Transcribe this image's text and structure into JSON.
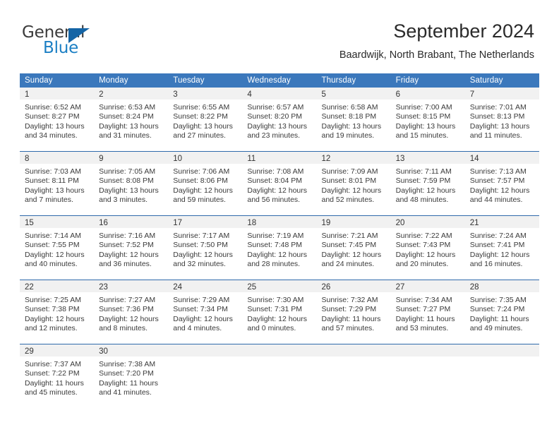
{
  "brand": {
    "word_one": "General",
    "word_two": "Blue",
    "triangle_color": "#1464a5",
    "blue_text_color": "#1b7fc4"
  },
  "header": {
    "title": "September 2024",
    "subtitle": "Baardwijk, North Brabant, The Netherlands"
  },
  "theme": {
    "header_blue": "#3b78bc",
    "daynum_band": "#f1f1f1",
    "row_divider": "#2f6aab",
    "text": "#3a3a3a"
  },
  "weekdays": [
    "Sunday",
    "Monday",
    "Tuesday",
    "Wednesday",
    "Thursday",
    "Friday",
    "Saturday"
  ],
  "weeks": [
    [
      {
        "day": "1",
        "info": "Sunrise: 6:52 AM\nSunset: 8:27 PM\nDaylight: 13 hours\nand 34 minutes."
      },
      {
        "day": "2",
        "info": "Sunrise: 6:53 AM\nSunset: 8:24 PM\nDaylight: 13 hours\nand 31 minutes."
      },
      {
        "day": "3",
        "info": "Sunrise: 6:55 AM\nSunset: 8:22 PM\nDaylight: 13 hours\nand 27 minutes."
      },
      {
        "day": "4",
        "info": "Sunrise: 6:57 AM\nSunset: 8:20 PM\nDaylight: 13 hours\nand 23 minutes."
      },
      {
        "day": "5",
        "info": "Sunrise: 6:58 AM\nSunset: 8:18 PM\nDaylight: 13 hours\nand 19 minutes."
      },
      {
        "day": "6",
        "info": "Sunrise: 7:00 AM\nSunset: 8:15 PM\nDaylight: 13 hours\nand 15 minutes."
      },
      {
        "day": "7",
        "info": "Sunrise: 7:01 AM\nSunset: 8:13 PM\nDaylight: 13 hours\nand 11 minutes."
      }
    ],
    [
      {
        "day": "8",
        "info": "Sunrise: 7:03 AM\nSunset: 8:11 PM\nDaylight: 13 hours\nand 7 minutes."
      },
      {
        "day": "9",
        "info": "Sunrise: 7:05 AM\nSunset: 8:08 PM\nDaylight: 13 hours\nand 3 minutes."
      },
      {
        "day": "10",
        "info": "Sunrise: 7:06 AM\nSunset: 8:06 PM\nDaylight: 12 hours\nand 59 minutes."
      },
      {
        "day": "11",
        "info": "Sunrise: 7:08 AM\nSunset: 8:04 PM\nDaylight: 12 hours\nand 56 minutes."
      },
      {
        "day": "12",
        "info": "Sunrise: 7:09 AM\nSunset: 8:01 PM\nDaylight: 12 hours\nand 52 minutes."
      },
      {
        "day": "13",
        "info": "Sunrise: 7:11 AM\nSunset: 7:59 PM\nDaylight: 12 hours\nand 48 minutes."
      },
      {
        "day": "14",
        "info": "Sunrise: 7:13 AM\nSunset: 7:57 PM\nDaylight: 12 hours\nand 44 minutes."
      }
    ],
    [
      {
        "day": "15",
        "info": "Sunrise: 7:14 AM\nSunset: 7:55 PM\nDaylight: 12 hours\nand 40 minutes."
      },
      {
        "day": "16",
        "info": "Sunrise: 7:16 AM\nSunset: 7:52 PM\nDaylight: 12 hours\nand 36 minutes."
      },
      {
        "day": "17",
        "info": "Sunrise: 7:17 AM\nSunset: 7:50 PM\nDaylight: 12 hours\nand 32 minutes."
      },
      {
        "day": "18",
        "info": "Sunrise: 7:19 AM\nSunset: 7:48 PM\nDaylight: 12 hours\nand 28 minutes."
      },
      {
        "day": "19",
        "info": "Sunrise: 7:21 AM\nSunset: 7:45 PM\nDaylight: 12 hours\nand 24 minutes."
      },
      {
        "day": "20",
        "info": "Sunrise: 7:22 AM\nSunset: 7:43 PM\nDaylight: 12 hours\nand 20 minutes."
      },
      {
        "day": "21",
        "info": "Sunrise: 7:24 AM\nSunset: 7:41 PM\nDaylight: 12 hours\nand 16 minutes."
      }
    ],
    [
      {
        "day": "22",
        "info": "Sunrise: 7:25 AM\nSunset: 7:38 PM\nDaylight: 12 hours\nand 12 minutes."
      },
      {
        "day": "23",
        "info": "Sunrise: 7:27 AM\nSunset: 7:36 PM\nDaylight: 12 hours\nand 8 minutes."
      },
      {
        "day": "24",
        "info": "Sunrise: 7:29 AM\nSunset: 7:34 PM\nDaylight: 12 hours\nand 4 minutes."
      },
      {
        "day": "25",
        "info": "Sunrise: 7:30 AM\nSunset: 7:31 PM\nDaylight: 12 hours\nand 0 minutes."
      },
      {
        "day": "26",
        "info": "Sunrise: 7:32 AM\nSunset: 7:29 PM\nDaylight: 11 hours\nand 57 minutes."
      },
      {
        "day": "27",
        "info": "Sunrise: 7:34 AM\nSunset: 7:27 PM\nDaylight: 11 hours\nand 53 minutes."
      },
      {
        "day": "28",
        "info": "Sunrise: 7:35 AM\nSunset: 7:24 PM\nDaylight: 11 hours\nand 49 minutes."
      }
    ],
    [
      {
        "day": "29",
        "info": "Sunrise: 7:37 AM\nSunset: 7:22 PM\nDaylight: 11 hours\nand 45 minutes."
      },
      {
        "day": "30",
        "info": "Sunrise: 7:38 AM\nSunset: 7:20 PM\nDaylight: 11 hours\nand 41 minutes."
      },
      {
        "day": "",
        "info": ""
      },
      {
        "day": "",
        "info": ""
      },
      {
        "day": "",
        "info": ""
      },
      {
        "day": "",
        "info": ""
      },
      {
        "day": "",
        "info": ""
      }
    ]
  ]
}
